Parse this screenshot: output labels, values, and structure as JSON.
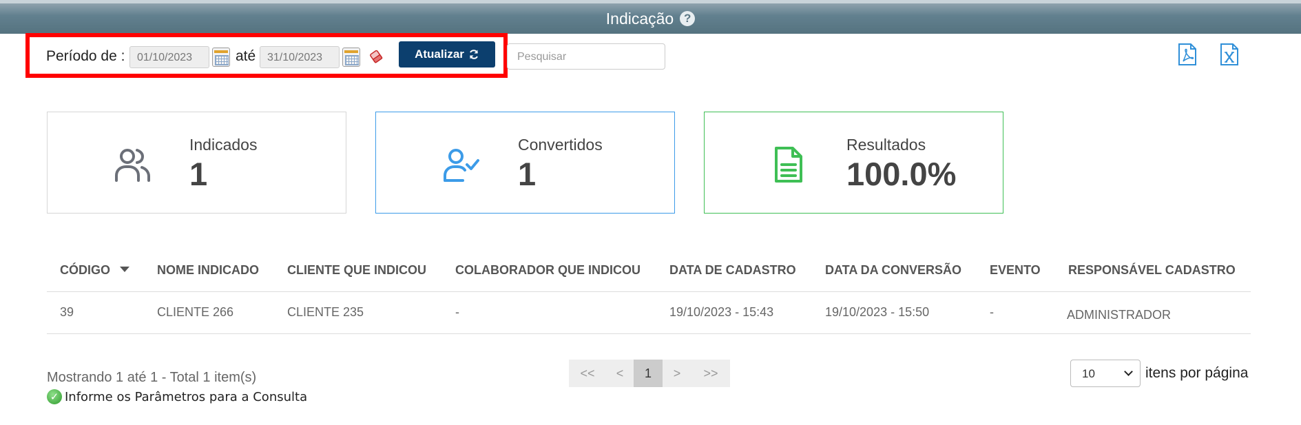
{
  "header": {
    "title": "Indicação",
    "help_icon": "question-circle-icon"
  },
  "filter": {
    "period_label": "Período de :",
    "start_date": "01/10/2023",
    "until_label": "até",
    "end_date": "31/10/2023",
    "update_button": "Atualizar",
    "search_placeholder": "Pesquisar"
  },
  "exports": {
    "pdf_icon": "pdf-file-icon",
    "excel_icon": "excel-file-icon"
  },
  "cards": [
    {
      "label": "Indicados",
      "value": "1",
      "icon": "users-icon",
      "color": "#6b6f78"
    },
    {
      "label": "Convertidos",
      "value": "1",
      "icon": "user-check-icon",
      "color": "#3c9be8"
    },
    {
      "label": "Resultados",
      "value": "100.0%",
      "icon": "document-icon",
      "color": "#3fbf55"
    }
  ],
  "table": {
    "columns": [
      "CÓDIGO",
      "NOME INDICADO",
      "CLIENTE QUE INDICOU",
      "COLABORADOR QUE INDICOU",
      "DATA DE CADASTRO",
      "DATA DA CONVERSÃO",
      "EVENTO",
      "RESPONSÁVEL CADASTRO"
    ],
    "rows": [
      [
        "39",
        "CLIENTE 266",
        "CLIENTE 235",
        "-",
        "19/10/2023 - 15:43",
        "19/10/2023 - 15:50",
        "-",
        "ADMINISTRADOR"
      ]
    ]
  },
  "footer": {
    "showing": "Mostrando 1 até 1 - Total 1 item(s)",
    "info": "Informe os Parâmetros para a Consulta",
    "pagination": {
      "first": "<<",
      "prev": "<",
      "current": "1",
      "next": ">",
      "last": ">>"
    },
    "per_page_value": "10",
    "per_page_label": "itens por página"
  }
}
